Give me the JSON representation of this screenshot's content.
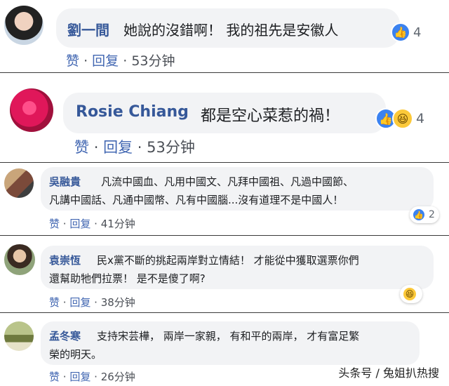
{
  "comments": [
    {
      "name": "劉一間",
      "text": "她說的沒錯啊！ 我的祖先是安徽人",
      "actions": {
        "like": "赞",
        "reply": "回复",
        "time": "53分钟"
      },
      "reaction_count": "4",
      "reaction_icons": [
        "like-icon"
      ]
    },
    {
      "name": "Rosie Chiang",
      "text": "都是空心菜惹的禍！",
      "actions": {
        "like": "赞",
        "reply": "回复",
        "time": "53分钟"
      },
      "reaction_count": "4",
      "reaction_icons": [
        "like-icon",
        "haha-icon"
      ]
    },
    {
      "name": "吳融貴",
      "text_line1": "凡流中國血、凡用中國文、凡拜中國祖、凡過中國節、",
      "text_line2": "凡講中國話、凡通中國幣、凡有中國腦...沒有道理不是中國人！",
      "actions": {
        "like": "赞",
        "reply": "回复",
        "time": "41分钟"
      },
      "reaction_count": "2",
      "reaction_icons": [
        "like-icon"
      ]
    },
    {
      "name": "袁崇恆",
      "text_line1": "民x黨不斷的挑起兩岸對立情結！ 才能從中獲取選票你們",
      "text_line2": "還幫助牠們拉票！ 是不是傻了啊?",
      "actions": {
        "like": "赞",
        "reply": "回复",
        "time": "38分钟"
      },
      "reaction_count": "",
      "reaction_icons": [
        "haha-icon"
      ]
    },
    {
      "name": "孟冬寒",
      "text_line1": "支持宋芸樺， 兩岸一家親， 有和平的兩岸， 才有富足繁",
      "text_line2": "榮的明天。",
      "actions": {
        "like": "赞",
        "reply": "回复",
        "time": "26分钟"
      },
      "reaction_count": "",
      "reaction_icons": []
    }
  ],
  "separator": "·",
  "watermark": "头条号 / 兔姐扒热搜",
  "colors": {
    "name": "#365899",
    "bubble": "#f2f3f5",
    "like": "#3b82f0",
    "haha": "#fcc93a",
    "action_link": "#4267b2"
  }
}
